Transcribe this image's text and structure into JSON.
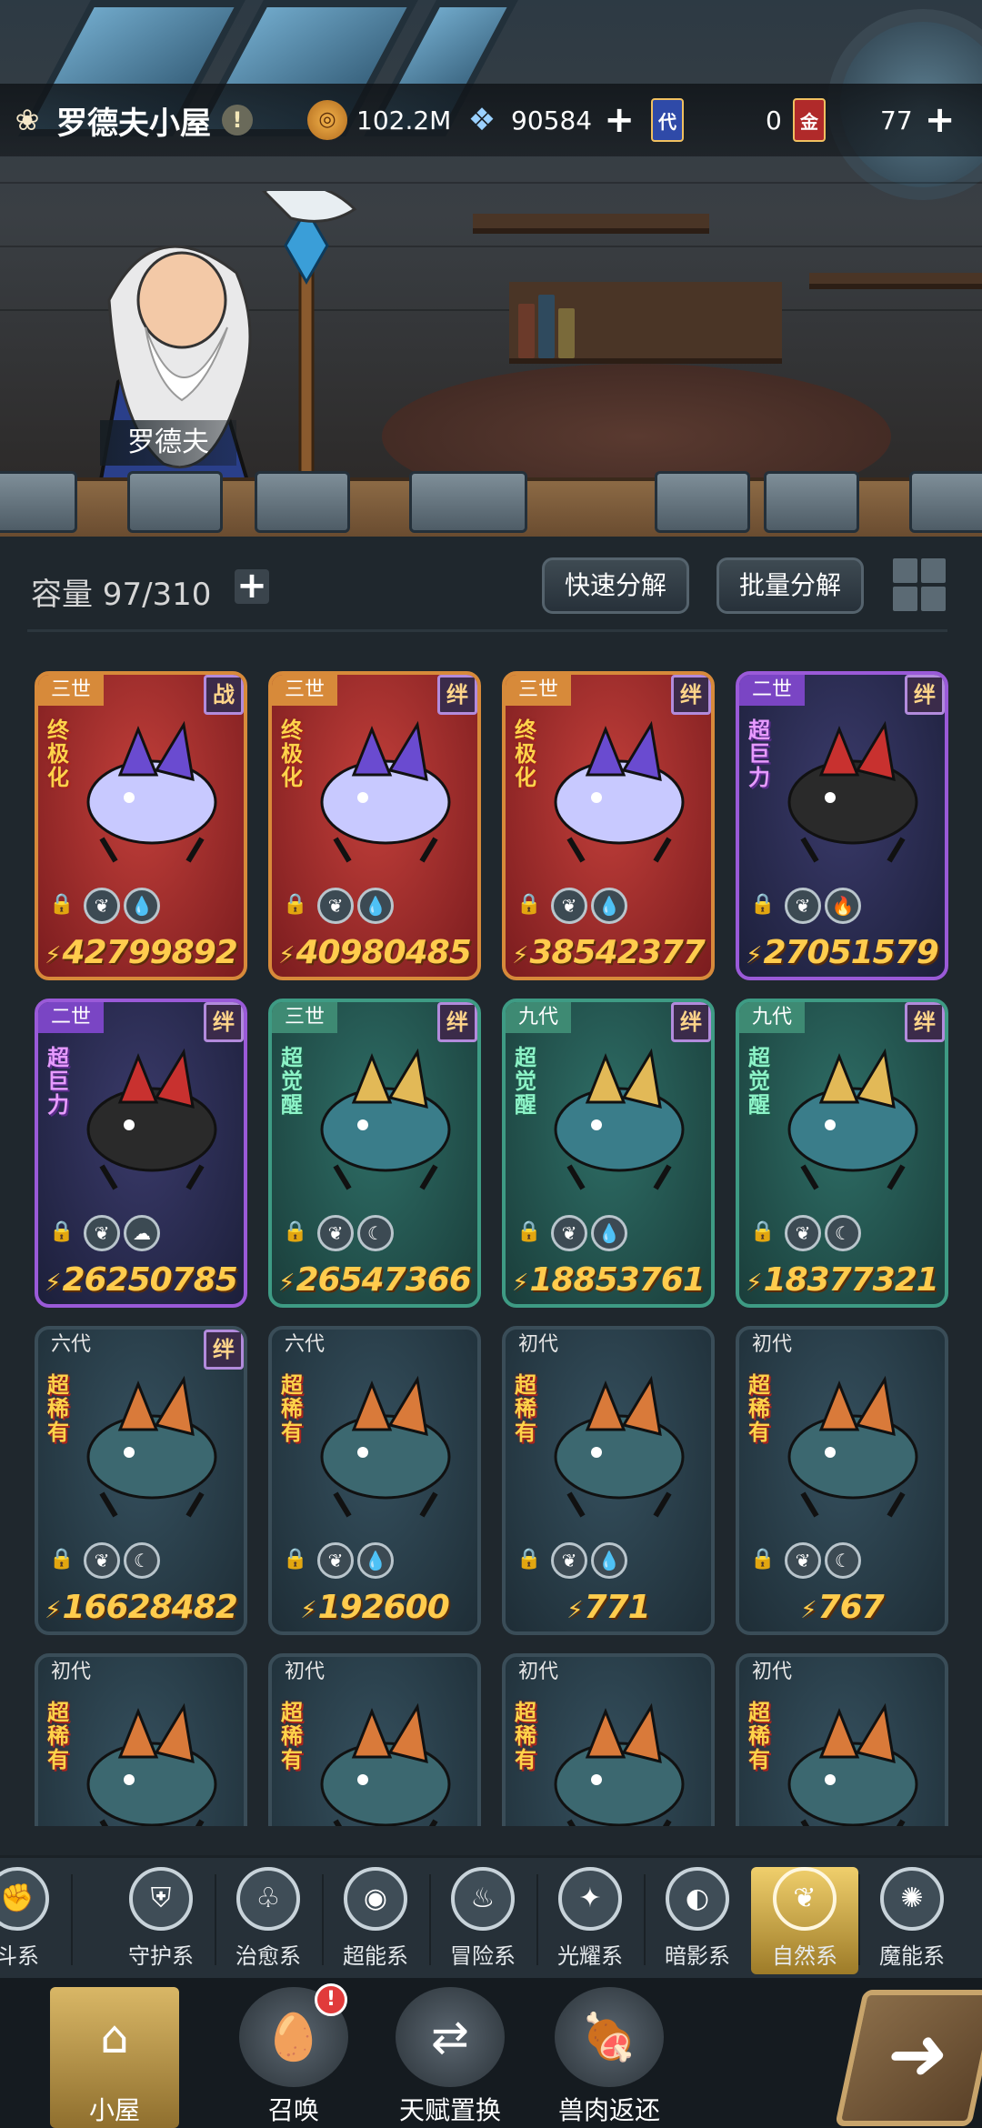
{
  "header": {
    "house_name": "罗德夫小屋",
    "warn_symbol": "!",
    "npc_name": "罗德夫",
    "paw_icon": "paw-icon"
  },
  "resources": {
    "gold": {
      "value": "102.2M",
      "icon": "coin-icon"
    },
    "crystal": {
      "value": "90584",
      "icon": "crystal-icon"
    },
    "card_dai": {
      "symbol": "代",
      "value": "0"
    },
    "card_jin": {
      "symbol": "金",
      "value": "77"
    },
    "plus": "+"
  },
  "inventory": {
    "capacity": "容量 97/310",
    "capacity_plus": "+",
    "quick_decompose": "快速分解",
    "batch_decompose": "批量分解"
  },
  "cards": [
    {
      "gen": "三世",
      "tag": "战",
      "rank": "终极化",
      "rank_style": "gold",
      "style": "red",
      "elems": [
        "leaf",
        "drop"
      ],
      "power": "42799892"
    },
    {
      "gen": "三世",
      "tag": "绊",
      "rank": "终极化",
      "rank_style": "gold",
      "style": "red",
      "elems": [
        "leaf",
        "drop"
      ],
      "power": "40980485"
    },
    {
      "gen": "三世",
      "tag": "绊",
      "rank": "终极化",
      "rank_style": "gold",
      "style": "red",
      "elems": [
        "leaf",
        "drop"
      ],
      "power": "38542377"
    },
    {
      "gen": "二世",
      "tag": "绊",
      "rank": "超巨力",
      "rank_style": "purple",
      "style": "purple",
      "elems": [
        "leaf",
        "fire"
      ],
      "power": "27051579"
    },
    {
      "gen": "二世",
      "tag": "绊",
      "rank": "超巨力",
      "rank_style": "purple",
      "style": "purple",
      "elems": [
        "leaf",
        "cloud"
      ],
      "power": "26250785"
    },
    {
      "gen": "三世",
      "tag": "绊",
      "rank": "超觉醒",
      "rank_style": "green",
      "style": "teal",
      "elems": [
        "leaf",
        "moon"
      ],
      "power": "26547366"
    },
    {
      "gen": "九代",
      "tag": "绊",
      "rank": "超觉醒",
      "rank_style": "green",
      "style": "teal",
      "elems": [
        "leaf",
        "drop"
      ],
      "power": "18853761"
    },
    {
      "gen": "九代",
      "tag": "绊",
      "rank": "超觉醒",
      "rank_style": "green",
      "style": "teal",
      "elems": [
        "leaf",
        "moon"
      ],
      "power": "18377321"
    },
    {
      "gen": "六代",
      "tag": "绊",
      "rank": "超稀有",
      "rank_style": "gold",
      "style": "slate",
      "elems": [
        "leaf",
        "moon"
      ],
      "power": "16628482"
    },
    {
      "gen": "六代",
      "tag": "",
      "rank": "超稀有",
      "rank_style": "gold",
      "style": "slate",
      "elems": [
        "leaf",
        "drop"
      ],
      "power": "192600"
    },
    {
      "gen": "初代",
      "tag": "",
      "rank": "超稀有",
      "rank_style": "gold",
      "style": "slate",
      "elems": [
        "leaf",
        "drop"
      ],
      "power": "771"
    },
    {
      "gen": "初代",
      "tag": "",
      "rank": "超稀有",
      "rank_style": "gold",
      "style": "slate",
      "elems": [
        "leaf",
        "moon"
      ],
      "power": "767"
    },
    {
      "gen": "初代",
      "tag": "",
      "rank": "超稀有",
      "rank_style": "gold",
      "style": "slate",
      "elems": [],
      "power": ""
    },
    {
      "gen": "初代",
      "tag": "",
      "rank": "超稀有",
      "rank_style": "gold",
      "style": "slate",
      "elems": [],
      "power": ""
    },
    {
      "gen": "初代",
      "tag": "",
      "rank": "超稀有",
      "rank_style": "gold",
      "style": "slate",
      "elems": [],
      "power": ""
    },
    {
      "gen": "初代",
      "tag": "",
      "rank": "超稀有",
      "rank_style": "gold",
      "style": "slate",
      "elems": [],
      "power": ""
    }
  ],
  "categories": [
    {
      "label": "斗系",
      "icon": "fist-icon",
      "glyph": "✊"
    },
    {
      "label": "守护系",
      "icon": "shield-icon",
      "glyph": "⛨"
    },
    {
      "label": "治愈系",
      "icon": "sprout-icon",
      "glyph": "♧"
    },
    {
      "label": "超能系",
      "icon": "alien-icon",
      "glyph": "◉"
    },
    {
      "label": "冒险系",
      "icon": "flame-shield-icon",
      "glyph": "♨"
    },
    {
      "label": "光耀系",
      "icon": "star-burst-icon",
      "glyph": "✦"
    },
    {
      "label": "暗影系",
      "icon": "eye-icon",
      "glyph": "◐"
    },
    {
      "label": "自然系",
      "icon": "leaf-flame-icon",
      "glyph": "❦",
      "active": true
    },
    {
      "label": "魔能系",
      "icon": "magic-circle-icon",
      "glyph": "✺"
    }
  ],
  "bottom_nav": [
    {
      "label": "小屋",
      "icon": "house-icon",
      "glyph": "⌂",
      "active": true
    },
    {
      "label": "召唤",
      "icon": "egg-icon",
      "glyph": "🥚",
      "badge": "!"
    },
    {
      "label": "天赋置换",
      "icon": "swap-icon",
      "glyph": "⇄"
    },
    {
      "label": "兽肉返还",
      "icon": "meat-icon",
      "glyph": "🍖"
    }
  ],
  "go_button": "➜"
}
